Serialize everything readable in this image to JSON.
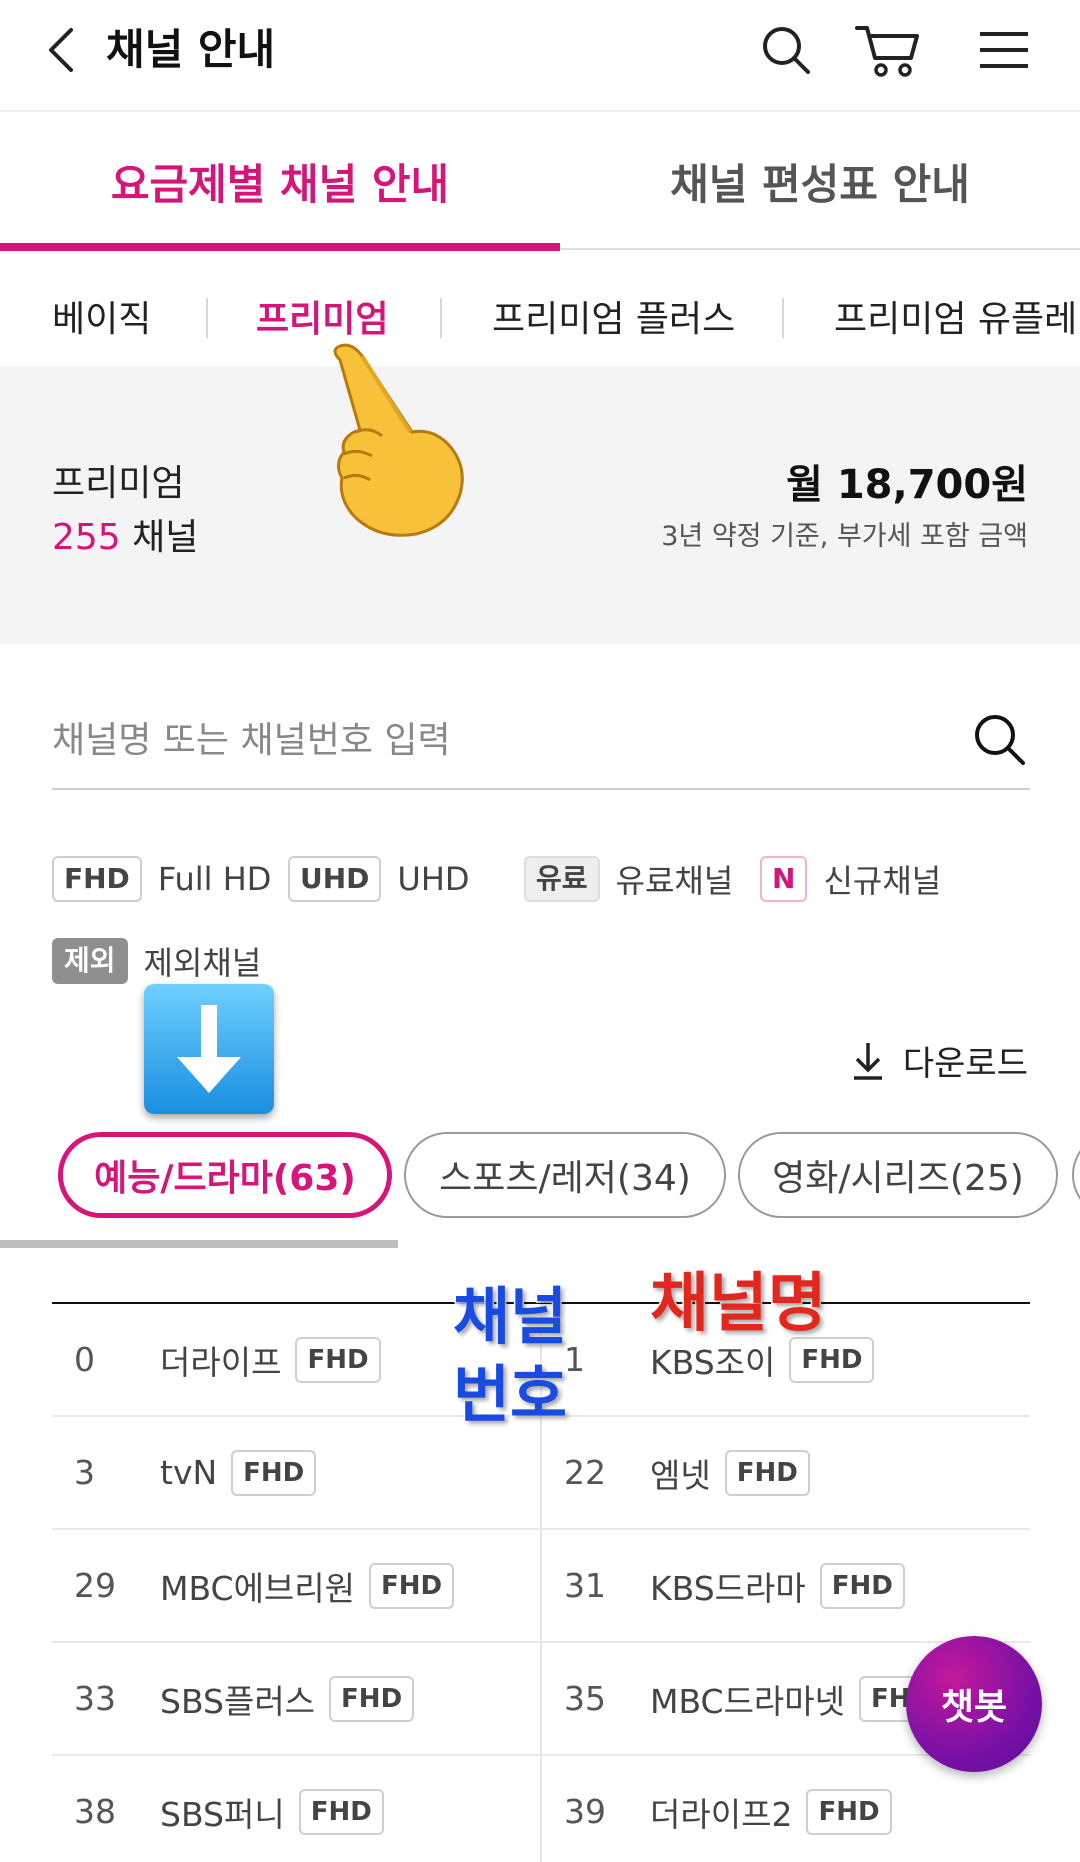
{
  "header": {
    "title": "채널 안내"
  },
  "main_tabs": [
    {
      "label": "요금제별 채널 안내",
      "active": true
    },
    {
      "label": "채널 편성표 안내",
      "active": false
    }
  ],
  "sub_tabs": [
    {
      "label": "베이직",
      "active": false
    },
    {
      "label": "프리미엄",
      "active": true
    },
    {
      "label": "프리미엄 플러스",
      "active": false
    },
    {
      "label": "프리미엄 유플레이",
      "active": false
    }
  ],
  "plan": {
    "name": "프리미엄",
    "channel_count": "255",
    "channel_unit": "채널",
    "price": "월 18,700원",
    "note": "3년 약정 기준, 부가세 포함 금액"
  },
  "search": {
    "placeholder": "채널명 또는 채널번호 입력"
  },
  "legend": [
    {
      "badge": "FHD",
      "label": "Full HD"
    },
    {
      "badge": "UHD",
      "label": "UHD"
    },
    {
      "badge": "유료",
      "label": "유료채널"
    },
    {
      "badge": "N",
      "label": "신규채널"
    },
    {
      "badge": "제외",
      "label": "제외채널"
    }
  ],
  "download": {
    "label": "다운로드"
  },
  "categories": [
    {
      "label": "예능/드라마(63)",
      "active": true
    },
    {
      "label": "스포츠/레저(34)",
      "active": false
    },
    {
      "label": "영화/시리즈(25)",
      "active": false
    }
  ],
  "channels": [
    [
      {
        "num": "0",
        "name": "더라이프",
        "badge": "FHD"
      },
      {
        "num": "1",
        "name": "KBS조이",
        "badge": "FHD"
      }
    ],
    [
      {
        "num": "3",
        "name": "tvN",
        "badge": "FHD"
      },
      {
        "num": "22",
        "name": "엠넷",
        "badge": "FHD"
      }
    ],
    [
      {
        "num": "29",
        "name": "MBC에브리원",
        "badge": "FHD"
      },
      {
        "num": "31",
        "name": "KBS드라마",
        "badge": "FHD"
      }
    ],
    [
      {
        "num": "33",
        "name": "SBS플러스",
        "badge": "FHD"
      },
      {
        "num": "35",
        "name": "MBC드라마넷",
        "badge": "FHD"
      }
    ],
    [
      {
        "num": "38",
        "name": "SBS퍼니",
        "badge": "FHD"
      },
      {
        "num": "39",
        "name": "더라이프2",
        "badge": "FHD"
      }
    ]
  ],
  "annotations": {
    "channel_number": "채널번호",
    "channel_name": "채널명"
  },
  "chatbot": {
    "label": "챗봇"
  },
  "colors": {
    "accent": "#d6157a",
    "annotation_blue": "#1a4be0",
    "annotation_red": "#e2281e",
    "chatbot_purple": "#7a11a6"
  }
}
